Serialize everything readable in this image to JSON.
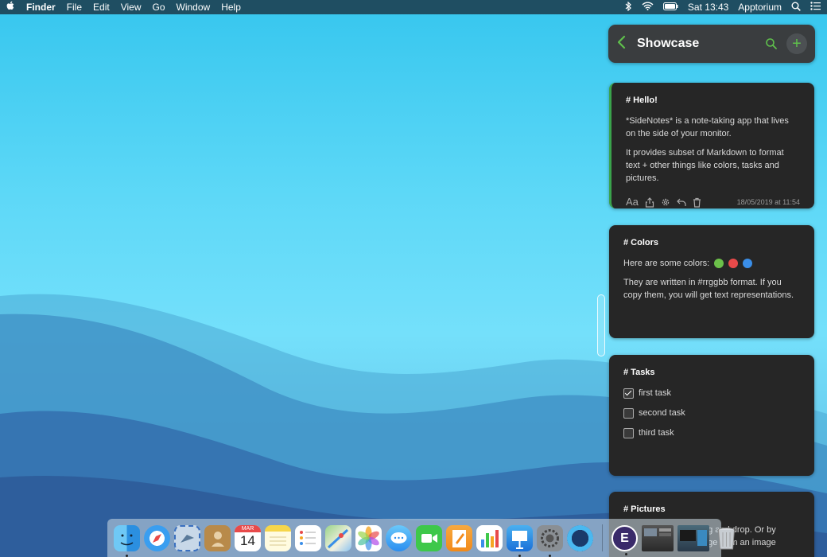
{
  "menubar": {
    "app": "Finder",
    "menus": [
      "File",
      "Edit",
      "View",
      "Go",
      "Window",
      "Help"
    ],
    "clock": "Sat 13:43",
    "user": "Apptorium"
  },
  "sidenotes": {
    "folder_title": "Showcase",
    "add_label": "+",
    "notes": {
      "hello": {
        "title": "# Hello!",
        "p1": "*SideNotes* is a note-taking app that lives on the side of your monitor.",
        "p2": "It provides subset of Markdown to format text + other things like colors, tasks and pictures.",
        "timestamp": "18/05/2019 at 11:54",
        "font_label": "Aa"
      },
      "colors": {
        "title": "# Colors",
        "intro": "Here are some colors:",
        "swatches": [
          "#6cc04a",
          "#e84a4a",
          "#3a8ee8"
        ],
        "p2": "They are written in #rrggbb format. If you copy them, you will get text representations."
      },
      "tasks": {
        "title": "# Tasks",
        "items": [
          {
            "label": "first task",
            "checked": true
          },
          {
            "label": "second task",
            "checked": false
          },
          {
            "label": "third task",
            "checked": false
          }
        ]
      },
      "pictures": {
        "title": "# Pictures",
        "line1": "ag and drop. Or by",
        "line2": "age from an image"
      }
    }
  },
  "dock": {
    "apps": [
      "finder",
      "safari",
      "mail",
      "contacts",
      "calendar",
      "notes",
      "reminders",
      "maps",
      "photos",
      "messages",
      "facetime",
      "pages",
      "numbers",
      "keynote",
      "system-preferences",
      "quicktime",
      "e-app",
      "screenshot-1",
      "screenshot-2",
      "trash"
    ],
    "calendar_month": "MAR",
    "calendar_day": "14",
    "e_app_letter": "E"
  },
  "colors": {
    "accent": "#5fc04c",
    "card_bg": "#262626",
    "header_bg": "#3a3d3f"
  }
}
